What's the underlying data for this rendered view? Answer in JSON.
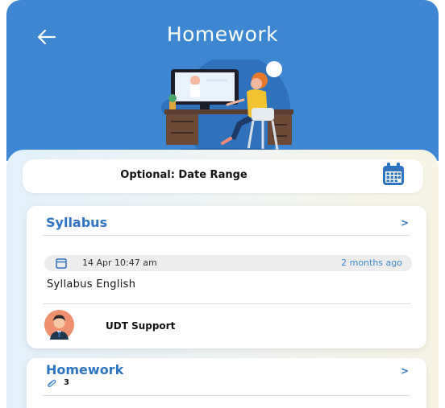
{
  "header": {
    "title": "Homework",
    "back_icon": "arrow-left-icon",
    "background": "#3d87d2"
  },
  "filter": {
    "label": "Optional: Date Range",
    "icon": "calendar-icon"
  },
  "cards": [
    {
      "title": "Syllabus",
      "chevron": ">",
      "date": "14 Apr 10:47 am",
      "ago": "2 months ago",
      "item": "Syllabus English",
      "author": "UDT Support"
    },
    {
      "title": "Homework",
      "chevron": ">",
      "attachments": "3",
      "attach_icon": "paperclip-icon"
    }
  ],
  "colors": {
    "accent": "#2e74c0",
    "header_bg": "#3d87d2"
  }
}
